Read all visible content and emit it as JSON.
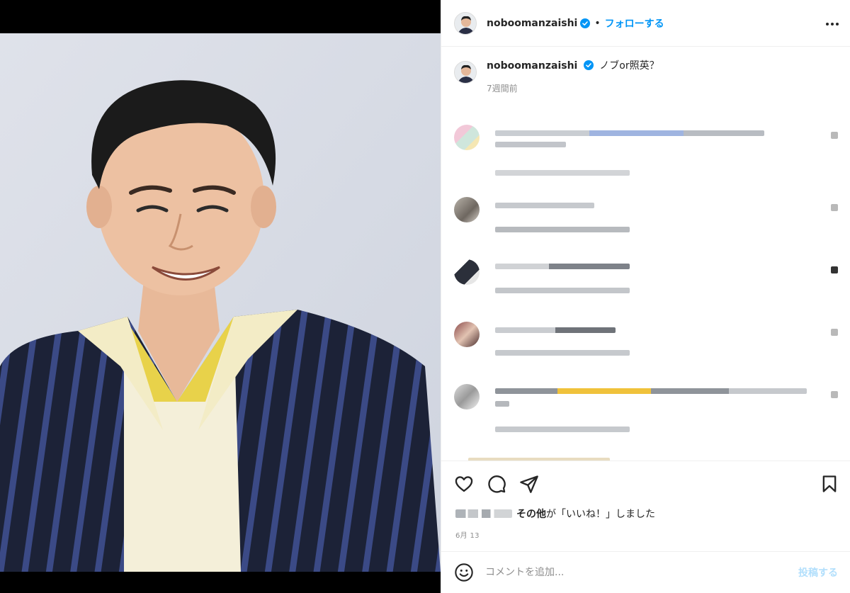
{
  "post": {
    "username": "noboomanzaishi",
    "follow_label": "フォローする",
    "dot": "•",
    "caption_text": "ノブor照英？",
    "caption_time": "7週間前",
    "likes_suffix_bold": "その他",
    "likes_suffix": "が「いいね！」しました",
    "date": "6月 13"
  },
  "comment_box": {
    "placeholder": "コメントを追加...",
    "post_label": "投稿する"
  },
  "icons": [
    "verified-badge-icon",
    "more-options-icon",
    "heart-icon",
    "comment-icon",
    "share-icon",
    "bookmark-icon",
    "emoji-icon"
  ],
  "colors": {
    "link_blue": "#0095f6",
    "post_button_disabled": "#b2dffc",
    "muted_text": "#8e8e8e",
    "border": "#efefef"
  }
}
